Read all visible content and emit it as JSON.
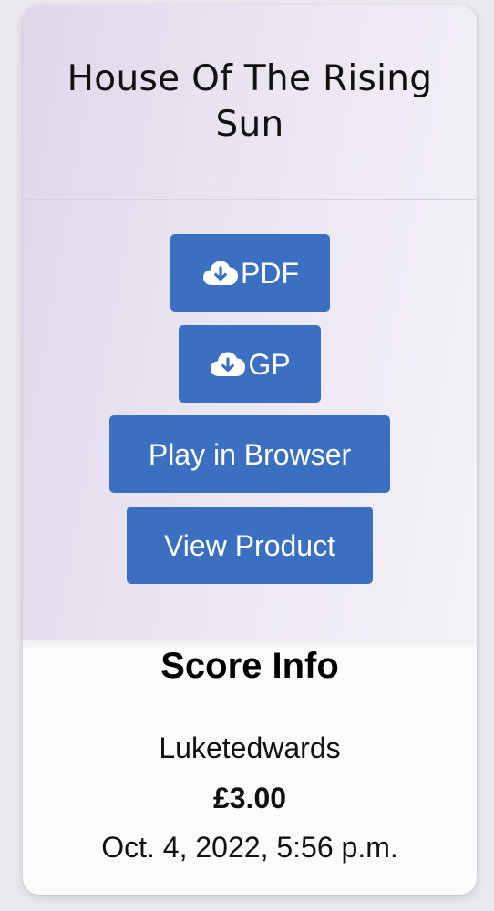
{
  "score": {
    "title": "House Of The Rising Sun"
  },
  "buttons": {
    "pdf": {
      "label": "PDF",
      "icon": "cloud-download-icon"
    },
    "gp": {
      "label": "GP",
      "icon": "cloud-download-icon"
    },
    "play": {
      "label": "Play in Browser"
    },
    "view": {
      "label": "View Product"
    }
  },
  "info": {
    "heading": "Score Info",
    "author": "Luketedwards",
    "price": "£3.00",
    "date": "Oct. 4, 2022, 5:56 p.m."
  },
  "colors": {
    "button_bg": "#3a6fc1",
    "button_text": "#ffffff",
    "card_header_gradient_start": "#e0d6ea",
    "card_body_bg": "#fbfafc"
  }
}
